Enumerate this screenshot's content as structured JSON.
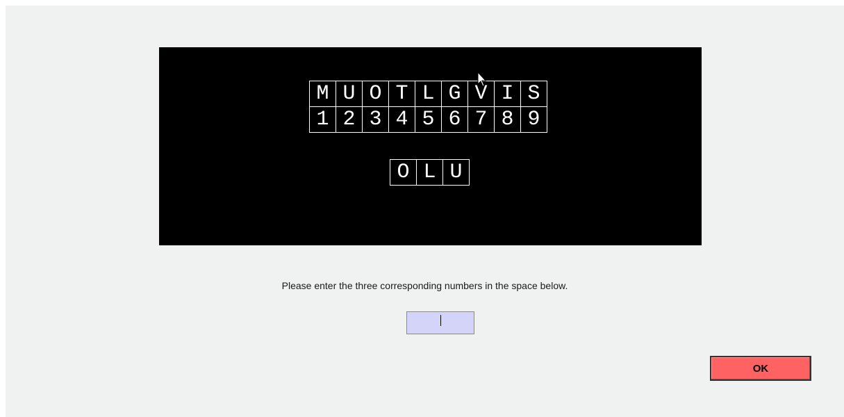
{
  "task": {
    "key_letters": [
      "M",
      "U",
      "O",
      "T",
      "L",
      "G",
      "V",
      "I",
      "S"
    ],
    "key_numbers": [
      "1",
      "2",
      "3",
      "4",
      "5",
      "6",
      "7",
      "8",
      "9"
    ],
    "probe_letters": [
      "O",
      "L",
      "U"
    ]
  },
  "instruction": "Please enter the three corresponding numbers in the space below.",
  "answer": {
    "value": "",
    "placeholder": ""
  },
  "buttons": {
    "ok_label": "OK"
  },
  "colors": {
    "stimulus_background": "#000000",
    "window_background": "#f0f1f1",
    "input_background": "#d4d4fb",
    "ok_button": "#ff6262"
  },
  "icons": {
    "pointer": "mouse-pointer-icon"
  }
}
